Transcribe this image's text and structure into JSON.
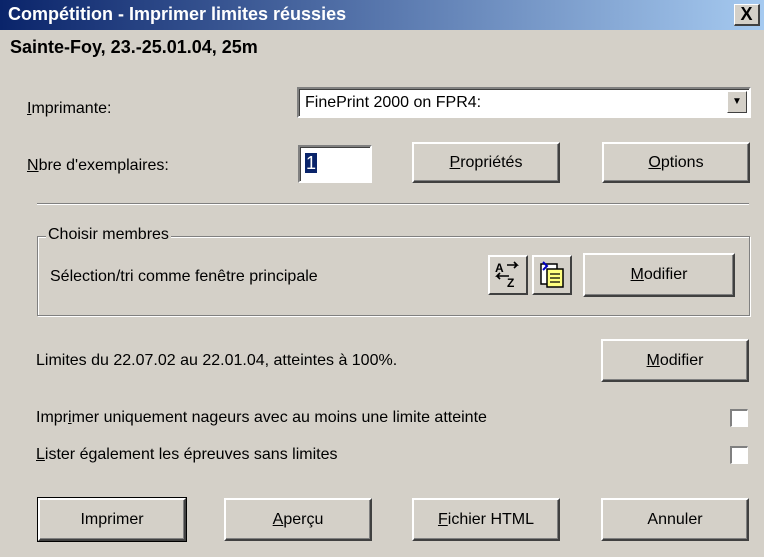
{
  "window": {
    "title": "Compétition - Imprimer limites réussies",
    "close_glyph": "X"
  },
  "subtitle": "Sainte-Foy, 23.-25.01.04, 25m",
  "printer": {
    "label_first": "I",
    "label_rest": "mprimante:",
    "value": "FinePrint 2000 on FPR4:"
  },
  "copies": {
    "label_first": "N",
    "label_rest": "bre d'exemplaires:",
    "value": "1"
  },
  "buttons": {
    "properties_first": "P",
    "properties_rest": "ropriétés",
    "options_first": "O",
    "options_rest": "ptions",
    "members_modify_first": "M",
    "members_modify_rest": "odifier",
    "limits_modify_first": "M",
    "limits_modify_rest": "odifier",
    "print": "Imprimer",
    "preview_first": "A",
    "preview_rest": "perçu",
    "html_first": "F",
    "html_rest": "ichier HTML",
    "cancel": "Annuler"
  },
  "members_group": {
    "title": "Choisir membres",
    "description": "Sélection/tri comme fenêtre principale",
    "sort_icon": "sort-az-icon",
    "select_icon": "select-list-icon"
  },
  "limits_text": "Limites du 22.07.02 au 22.01.04,  atteintes à 100%.",
  "options": {
    "only_swimmers_prefix": "Impr",
    "only_swimmers_mnemonic": "i",
    "only_swimmers_rest": "mer uniquement nageurs avec au moins une limite atteinte",
    "only_swimmers_checked": false,
    "list_events_first": "L",
    "list_events_rest": "ister également les épreuves sans limites",
    "list_events_checked": false
  }
}
